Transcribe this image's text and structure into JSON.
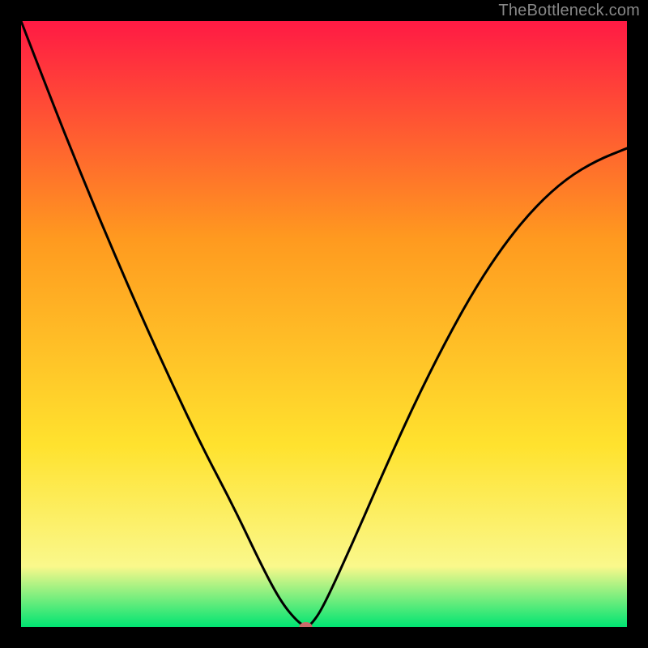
{
  "watermark": "TheBottleneck.com",
  "chart_data": {
    "type": "line",
    "title": "",
    "xlabel": "",
    "ylabel": "",
    "xlim": [
      0,
      1
    ],
    "ylim": [
      0,
      1
    ],
    "grid": false,
    "legend": false,
    "background_gradient": [
      "#ff1a44",
      "#ff9a1f",
      "#ffe22e",
      "#faf88b",
      "#00e472"
    ],
    "series": [
      {
        "name": "bottleneck-curve",
        "color": "#000000",
        "x": [
          0.0,
          0.05,
          0.1,
          0.15,
          0.2,
          0.25,
          0.3,
          0.35,
          0.4,
          0.43,
          0.455,
          0.47,
          0.48,
          0.5,
          0.55,
          0.6,
          0.65,
          0.7,
          0.75,
          0.8,
          0.85,
          0.9,
          0.95,
          1.0
        ],
        "values": [
          1.0,
          0.87,
          0.745,
          0.625,
          0.51,
          0.4,
          0.295,
          0.2,
          0.095,
          0.04,
          0.01,
          0.0,
          0.005,
          0.035,
          0.145,
          0.26,
          0.37,
          0.47,
          0.56,
          0.635,
          0.695,
          0.74,
          0.77,
          0.79
        ]
      }
    ],
    "marker": {
      "name": "optimum-point",
      "x": 0.47,
      "y": 0.0,
      "color": "#c96a6a",
      "shape": "ellipse"
    }
  }
}
